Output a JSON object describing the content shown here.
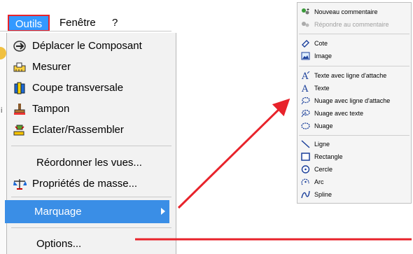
{
  "menubar": {
    "items": [
      "Outils",
      "Fenêtre",
      "?"
    ]
  },
  "tools_menu": {
    "items": [
      {
        "label": "Déplacer le Composant",
        "icon": "move-component-icon"
      },
      {
        "label": "Mesurer",
        "icon": "measure-icon"
      },
      {
        "label": "Coupe transversale",
        "icon": "cross-section-icon"
      },
      {
        "label": "Tampon",
        "icon": "stamp-icon"
      },
      {
        "label": "Eclater/Rassembler",
        "icon": "explode-icon"
      },
      {
        "label": "Réordonner les vues..."
      },
      {
        "label": "Propriétés de masse...",
        "icon": "mass-properties-icon"
      },
      {
        "label": "Marquage",
        "highlighted": true,
        "has_submenu": true
      },
      {
        "label": "Options..."
      }
    ]
  },
  "marking_submenu": {
    "items": [
      {
        "label": "Nouveau commentaire",
        "icon": "new-comment-icon"
      },
      {
        "label": "Répondre au commentaire",
        "icon": "reply-comment-icon",
        "disabled": true
      },
      {
        "label": "Cote",
        "icon": "dimension-icon"
      },
      {
        "label": "Image",
        "icon": "image-icon"
      },
      {
        "label": "Texte avec ligne d'attache",
        "icon": "text-leader-icon"
      },
      {
        "label": "Texte",
        "icon": "text-icon"
      },
      {
        "label": "Nuage avec ligne d'attache",
        "icon": "cloud-leader-icon"
      },
      {
        "label": "Nuage avec texte",
        "icon": "cloud-text-icon"
      },
      {
        "label": "Nuage",
        "icon": "cloud-icon"
      },
      {
        "label": "Ligne",
        "icon": "line-icon"
      },
      {
        "label": "Rectangle",
        "icon": "rectangle-icon"
      },
      {
        "label": "Cercle",
        "icon": "circle-icon"
      },
      {
        "label": "Arc",
        "icon": "arc-icon"
      },
      {
        "label": "Spline",
        "icon": "spline-icon"
      }
    ]
  },
  "colors": {
    "highlight": "#3a8ee6",
    "annotation_red": "#e8232b"
  }
}
